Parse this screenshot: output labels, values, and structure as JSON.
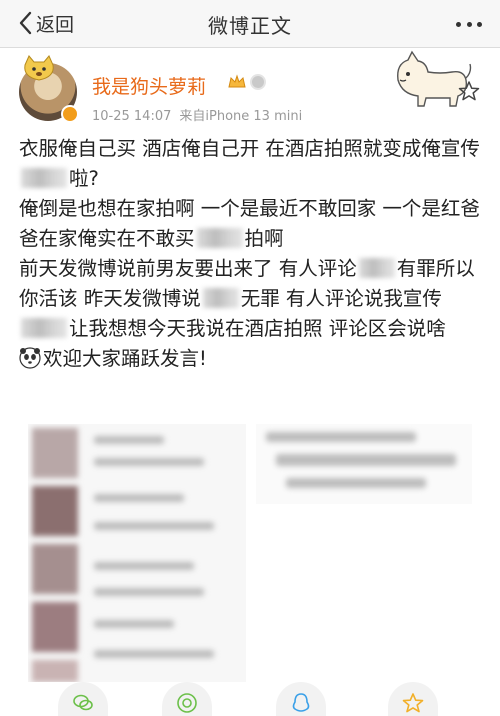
{
  "navbar": {
    "back_label": "返回",
    "title": "微博正文"
  },
  "post": {
    "author": "我是狗头萝莉",
    "date": "10-25 14:07",
    "source": "来自iPhone 13 mini",
    "paragraphs": [
      {
        "a": "衣服俺自己买 酒店俺自己开 在酒店拍照就变成俺宣传",
        "b": "啦?"
      },
      {
        "a": "俺倒是也想在家拍啊 一个是最近不敢回家 一个是红爸爸在家俺实在不敢买",
        "b": "拍啊"
      },
      {
        "a": "前天发微博说前男友要出来了 有人评论",
        "b": "有罪所以你活该 昨天发微博说",
        "c": "无罪 有人评论说我宣传",
        "d": "让我想想今天我说在酒店拍照 评论区会说啥"
      },
      {
        "a": "欢迎大家踊跃发言!"
      }
    ]
  },
  "colors": {
    "username": "#e86a1a",
    "meta": "#999999",
    "text": "#222222"
  },
  "icons": [
    "back-chevron-icon",
    "more-dots-icon",
    "star-icon",
    "wechat-icon",
    "moments-icon",
    "qq-icon",
    "qzone-icon"
  ]
}
